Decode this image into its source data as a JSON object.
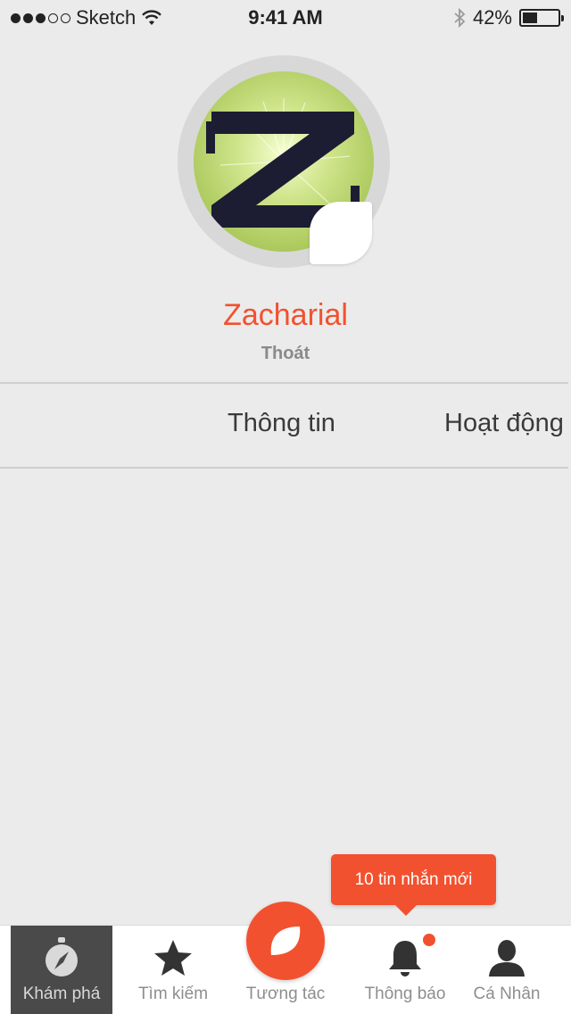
{
  "status_bar": {
    "carrier": "Sketch",
    "time": "9:41 AM",
    "battery_text": "42%",
    "battery_level": 0.42,
    "signal_bars_filled": 3,
    "signal_bars_total": 5
  },
  "profile": {
    "name": "Zacharial",
    "logout_label": "Thoát",
    "avatar_letter": "Z"
  },
  "tabs": [
    {
      "label": "Thông tin"
    },
    {
      "label": "Hoạt động"
    }
  ],
  "toast": {
    "message": "10 tin nhắn mới"
  },
  "tab_bar": {
    "items": [
      {
        "label": "Khám phá",
        "icon": "compass-icon",
        "active": true
      },
      {
        "label": "Tìm kiếm",
        "icon": "star-icon",
        "active": false
      },
      {
        "label": "Tương tác",
        "icon": "leaf-chat-icon",
        "active": false
      },
      {
        "label": "Thông báo",
        "icon": "bell-icon",
        "active": false
      },
      {
        "label": "Cá Nhân",
        "icon": "user-icon",
        "active": false
      }
    ]
  },
  "colors": {
    "accent": "#f2512f",
    "background": "#ebebeb",
    "active_tab_bg": "#4a4a4a"
  }
}
